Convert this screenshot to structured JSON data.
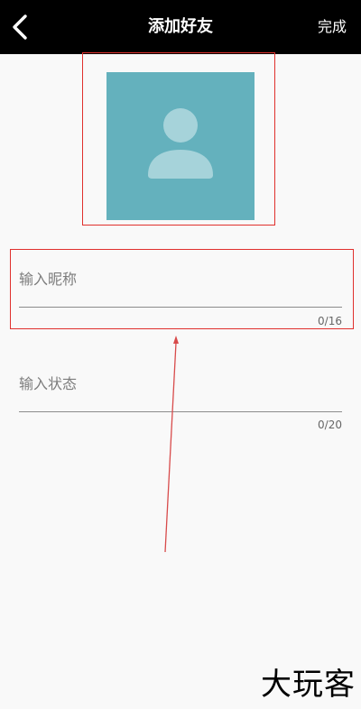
{
  "header": {
    "title": "添加好友",
    "done_label": "完成",
    "back_icon": "chevron-left-icon"
  },
  "avatar": {
    "icon": "person-icon",
    "background_color": "#64b1bd"
  },
  "nickname": {
    "placeholder": "输入昵称",
    "value": "",
    "counter": "0/16"
  },
  "status": {
    "placeholder": "输入状态",
    "value": "",
    "counter": "0/20"
  },
  "watermark": {
    "text": "大玩客"
  },
  "annotation": {
    "highlight_color": "#e0302d"
  }
}
